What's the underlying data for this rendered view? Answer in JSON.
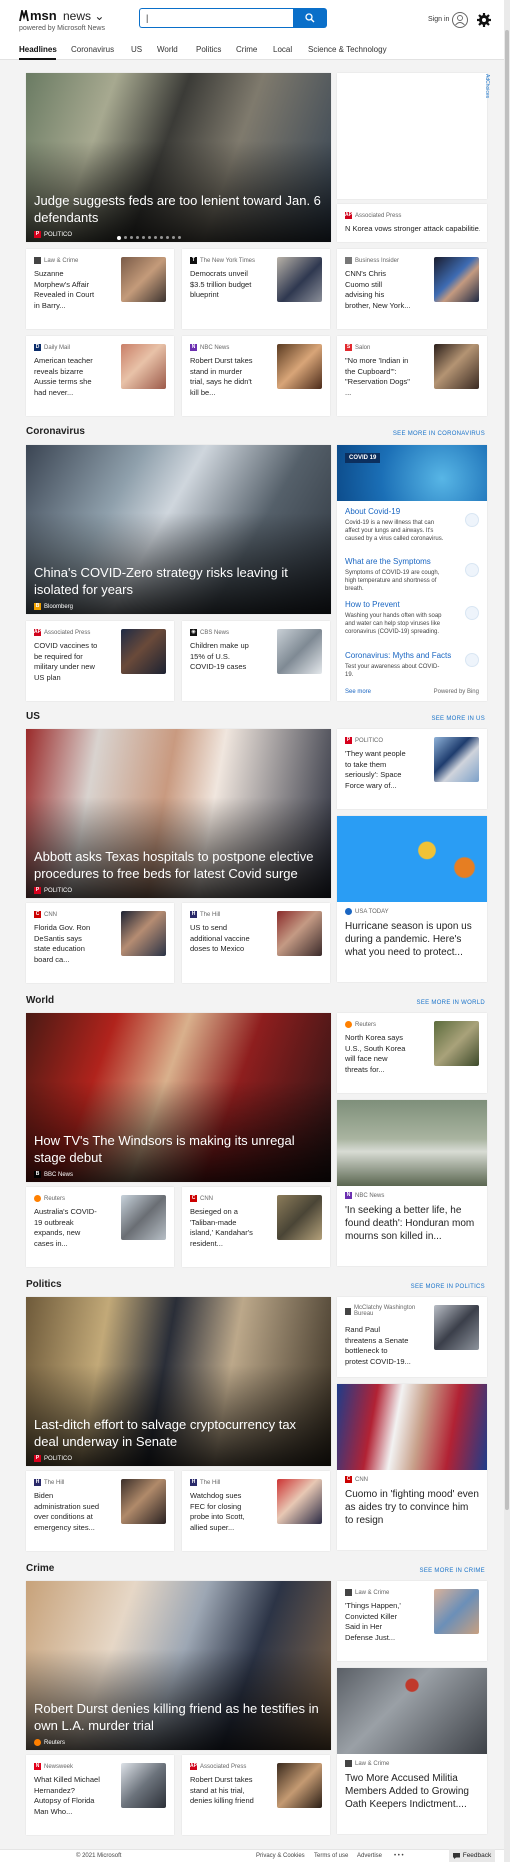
{
  "header": {
    "brand": "msn",
    "section": "news",
    "powered_by": "powered by Microsoft News",
    "search_value": "|",
    "signin": "Sign in"
  },
  "nav": [
    "Headlines",
    "Coronavirus",
    "US",
    "World",
    "Politics",
    "Crime",
    "Local",
    "Science & Technology"
  ],
  "adchoices": "AdChoices",
  "top": {
    "hero": {
      "title": "Judge suggests feds are too lenient toward Jan. 6 defendants",
      "source": "POLITICO"
    },
    "right_small": {
      "source": "Associated Press",
      "title": "N Korea vows stronger attack capabilitie..."
    },
    "row1": [
      {
        "source": "Law & Crime",
        "title": "Suzanne Morphew's Affair Revealed in Court in Barry..."
      },
      {
        "source": "The New York Times",
        "title": "Democrats unveil $3.5 trillion budget blueprint"
      },
      {
        "source": "Business Insider",
        "title": "CNN's Chris Cuomo still advising his brother, New York..."
      }
    ],
    "row2": [
      {
        "source": "Daily Mail",
        "title": "American teacher reveals bizarre Aussie terms she had never..."
      },
      {
        "source": "NBC News",
        "title": "Robert Durst takes stand in murder trial, says he didn't kill be..."
      },
      {
        "source": "Salon",
        "title": "\"No more 'Indian in the Cupboard'\": \"Reservation Dogs\" ..."
      }
    ]
  },
  "coronavirus": {
    "title": "Coronavirus",
    "link": "SEE MORE IN CORONAVIRUS",
    "hero": {
      "title": "China's COVID-Zero strategy risks leaving it isolated for years",
      "source": "Bloomberg"
    },
    "small": [
      {
        "source": "Associated Press",
        "title": "COVID vaccines to be required for military under new US plan"
      },
      {
        "source": "CBS News",
        "title": "Children make up 15% of U.S. COVID-19 cases"
      }
    ],
    "panel": {
      "tag": "COVID 19",
      "items": [
        {
          "heading": "About Covid-19",
          "desc": "Covid-19 is a new illness that can affect your lungs and airways. It's caused by a virus called coronavirus."
        },
        {
          "heading": "What are the Symptoms",
          "desc": "Symptoms of COVID-19 are cough, high temperature and shortness of breath."
        },
        {
          "heading": "How to Prevent",
          "desc": "Washing your hands often with soap and water can help stop viruses like coronavirus (COVID-19) spreading."
        },
        {
          "heading": "Coronavirus: Myths and Facts",
          "desc": "Test your awareness about COVID-19."
        }
      ],
      "see_more": "See more",
      "powered": "Powered by Bing"
    }
  },
  "us": {
    "title": "US",
    "link": "SEE MORE IN US",
    "hero": {
      "title": "Abbott asks Texas hospitals to postpone elective procedures to free beds for latest Covid surge",
      "source": "POLITICO"
    },
    "right_small": {
      "source": "POLITICO",
      "title": "'They want people to take them seriously': Space Force wary of..."
    },
    "tall": {
      "source": "USA TODAY",
      "title": "Hurricane season is upon us during a pandemic. Here's what you need to protect..."
    },
    "small": [
      {
        "source": "CNN",
        "title": "Florida Gov. Ron DeSantis says state education board ca..."
      },
      {
        "source": "The Hill",
        "title": "US to send additional vaccine doses to Mexico"
      }
    ]
  },
  "world": {
    "title": "World",
    "link": "SEE MORE IN WORLD",
    "hero": {
      "title": "How TV's The Windsors is making its unregal stage debut",
      "source": "BBC News"
    },
    "right_small": {
      "source": "Reuters",
      "title": "North Korea says U.S., South Korea will face new threats for..."
    },
    "tall": {
      "source": "NBC News",
      "title": "'In seeking a better life, he found death': Honduran mom mourns son killed in..."
    },
    "small": [
      {
        "source": "Reuters",
        "title": "Australia's COVID-19 outbreak expands, new cases in..."
      },
      {
        "source": "CNN",
        "title": "Besieged on a 'Taliban-made island,' Kandahar's resident..."
      }
    ]
  },
  "politics": {
    "title": "Politics",
    "link": "SEE MORE IN POLITICS",
    "hero": {
      "title": "Last-ditch effort to salvage cryptocurrency tax deal underway in Senate",
      "source": "POLITICO"
    },
    "right_small": {
      "source": "McClatchy Washington Bureau",
      "title": "Rand Paul threatens a Senate bottleneck to protest COVID-19..."
    },
    "tall": {
      "source": "CNN",
      "title": "Cuomo in 'fighting mood' even as aides try to convince him to resign"
    },
    "small": [
      {
        "source": "The Hill",
        "title": "Biden administration sued over conditions at emergency sites..."
      },
      {
        "source": "The Hill",
        "title": "Watchdog sues FEC for closing probe into Scott, allied super..."
      }
    ]
  },
  "crime": {
    "title": "Crime",
    "link": "SEE MORE IN CRIME",
    "hero": {
      "title": "Robert Durst denies killing friend as he testifies in own L.A. murder trial",
      "source": "Reuters"
    },
    "right_small": {
      "source": "Law & Crime",
      "title": "'Things Happen,' Convicted Killer Said in Her Defense Just..."
    },
    "tall": {
      "source": "Law & Crime",
      "title": "Two More Accused Militia Members Added to Growing Oath Keepers Indictment...."
    },
    "small": [
      {
        "source": "Newsweek",
        "title": "What Killed Michael Hernandez? Autopsy of Florida Man Who..."
      },
      {
        "source": "Associated Press",
        "title": "Robert Durst takes stand at his trial, denies killing friend"
      }
    ]
  },
  "footer": {
    "copyright": "© 2021 Microsoft",
    "privacy": "Privacy & Cookies",
    "terms": "Terms of use",
    "advertise": "Advertise",
    "more": "• • •",
    "feedback": "Feedback"
  },
  "colors": {
    "accent": "#0a6fc9",
    "link": "#1a73c9",
    "politico": "#d6001c",
    "page_bg": "#f3f3f3"
  }
}
